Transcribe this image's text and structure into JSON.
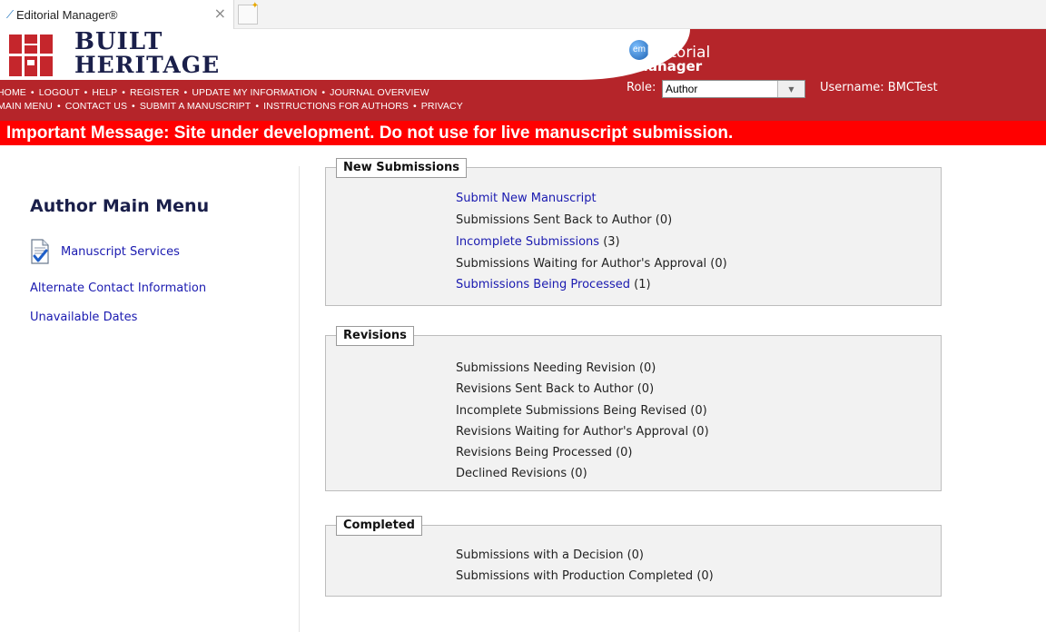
{
  "browser": {
    "tab_title": "Editorial Manager®",
    "tab_close": "×"
  },
  "header": {
    "logo_line1": "BUILT",
    "logo_line2": "HERITAGE",
    "nav_row1": [
      "HOME",
      "LOGOUT",
      "HELP",
      "REGISTER",
      "UPDATE MY INFORMATION",
      "JOURNAL OVERVIEW"
    ],
    "nav_row2": [
      "MAIN MENU",
      "CONTACT US",
      "SUBMIT A MANUSCRIPT",
      "INSTRUCTIONS FOR AUTHORS",
      "PRIVACY"
    ],
    "nav_separator": "•",
    "em_badge": "em",
    "em_line1": "Editorial",
    "em_line2": "Manager",
    "role_label": "Role:",
    "role_value": "Author",
    "username": "Username: BMCTest",
    "brand_red": "#b5252a"
  },
  "important_message": "Important Message: Site under development. Do not use for live manuscript submission.",
  "left": {
    "title": "Author Main Menu",
    "links": [
      "Manuscript Services",
      "Alternate Contact Information",
      "Unavailable Dates"
    ]
  },
  "sections": {
    "new_submissions": {
      "title": "New Submissions",
      "items": [
        {
          "link": "Submit New Manuscript",
          "text": ""
        },
        {
          "link": "",
          "text": "Submissions Sent Back to Author (0)"
        },
        {
          "link": "Incomplete Submissions",
          "text": " (3)"
        },
        {
          "link": "",
          "text": "Submissions Waiting for Author's Approval (0)"
        },
        {
          "link": "Submissions Being Processed",
          "text": " (1)"
        }
      ]
    },
    "revisions": {
      "title": "Revisions",
      "items": [
        "Submissions Needing Revision (0)",
        "Revisions Sent Back to Author (0)",
        "Incomplete Submissions Being Revised (0)",
        "Revisions Waiting for Author's Approval (0)",
        "Revisions Being Processed  (0)",
        "Declined Revisions (0)"
      ]
    },
    "completed": {
      "title": "Completed",
      "items": [
        "Submissions with a Decision (0)",
        "Submissions with Production Completed (0)"
      ]
    }
  }
}
